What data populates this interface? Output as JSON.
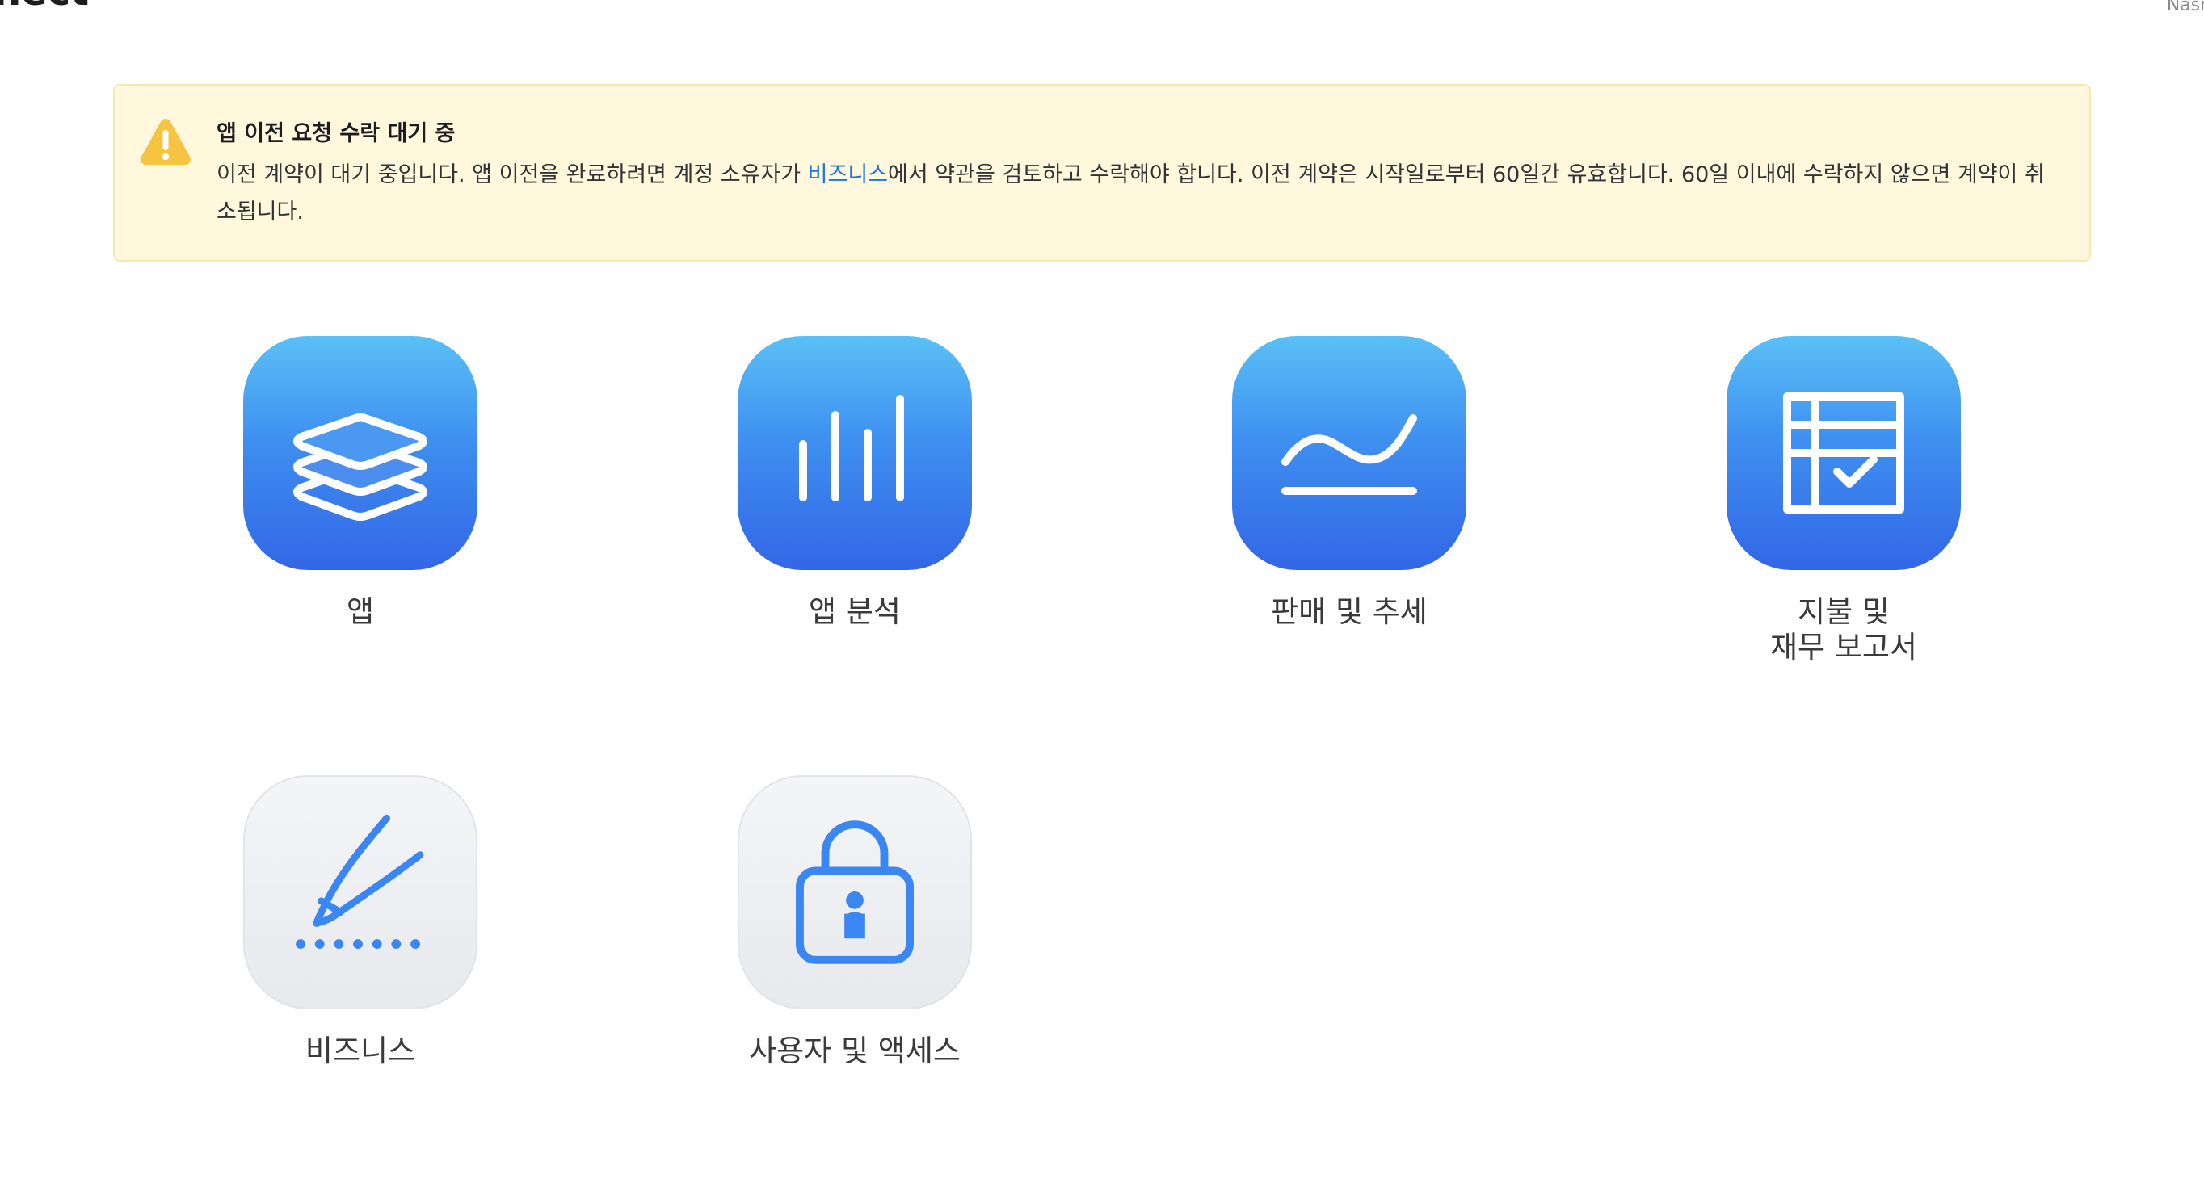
{
  "header": {
    "title": "nect",
    "user_name": "Nasmo"
  },
  "banner": {
    "title": "앱 이전 요청 수락 대기 중",
    "text_before_link": "이전 계약이 대기 중입니다. 앱 이전을 완료하려면 계정 소유자가 ",
    "link_text": "비즈니스",
    "text_after_link": "에서 약관을 검토하고 수락해야 합니다. 이전 계약은 시작일로부터 60일간 유효합니다. 60일 이내에 수락하지 않으면 계약이 취소됩니다.",
    "icon": "warning-triangle-icon"
  },
  "tiles": [
    {
      "label": "앱",
      "icon": "layers-stack-icon"
    },
    {
      "label": "앱 분석",
      "icon": "bar-chart-icon"
    },
    {
      "label": "판매 및 추세",
      "icon": "trend-line-icon"
    },
    {
      "label": "지불 및\n재무 보고서",
      "icon": "table-check-icon"
    },
    {
      "label": "비즈니스",
      "icon": "pen-signature-icon"
    },
    {
      "label": "사용자 및 액세스",
      "icon": "lock-icon"
    }
  ],
  "colors": {
    "banner_background": "#fff8dd",
    "banner_border": "#f6e8b3",
    "warning_yellow": "#f5c542",
    "link_blue": "#1a73e8",
    "tile_blue_top": "#5ac0f6",
    "tile_blue_bottom": "#3366e6",
    "tile_gray": "#eceef1",
    "icon_blue": "#3478f6"
  }
}
